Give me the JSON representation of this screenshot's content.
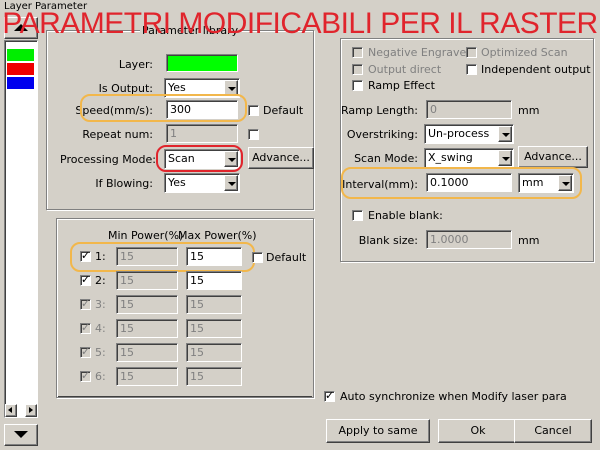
{
  "window": {
    "title": "Layer Parameter"
  },
  "overlay": {
    "text": "PARAMETRI MODIFICABILI PER IL RASTER"
  },
  "left_panel": {
    "swatches": [
      {
        "color": "#00ee00"
      },
      {
        "color": "#ee0000"
      },
      {
        "color": "#0000ee"
      }
    ]
  },
  "params": {
    "group_title": "Parameter library",
    "layer_label": "Layer:",
    "layer_color": "#00ff00",
    "is_output_label": "Is Output:",
    "is_output_value": "Yes",
    "speed_label": "Speed(mm/s):",
    "speed_value": "300",
    "default_label": "Default",
    "repeat_label": "Repeat num:",
    "repeat_value": "1",
    "processing_label": "Processing Mode:",
    "processing_value": "Scan",
    "advance_label": "Advance...",
    "blowing_label": "If Blowing:",
    "blowing_value": "Yes"
  },
  "power": {
    "min_header": "Min Power(%)",
    "max_header": "Max Power(%)",
    "default_label": "Default",
    "rows": [
      {
        "label": "1:",
        "min": "15",
        "max": "15"
      },
      {
        "label": "2:",
        "min": "15",
        "max": "15"
      },
      {
        "label": "3:",
        "min": "15",
        "max": "15"
      },
      {
        "label": "4:",
        "min": "15",
        "max": "15"
      },
      {
        "label": "5:",
        "min": "15",
        "max": "15"
      },
      {
        "label": "6:",
        "min": "15",
        "max": "15"
      }
    ]
  },
  "right": {
    "negative_engrave": "Negative Engrave",
    "optimized_scan": "Optimized Scan",
    "output_direct": "Output direct",
    "independent_output": "Independent output",
    "ramp_effect": "Ramp Effect",
    "ramp_length_label": "Ramp Length:",
    "ramp_length_value": "0",
    "unit_mm": "mm",
    "overstriking_label": "Overstriking:",
    "overstriking_value": "Un-process",
    "scan_mode_label": "Scan Mode:",
    "scan_mode_value": "X_swing",
    "advance_label": "Advance...",
    "interval_label": "Interval(mm):",
    "interval_value": "0.1000",
    "interval_unit": "mm",
    "enable_blank": "Enable blank:",
    "blank_size_label": "Blank size:",
    "blank_size_value": "1.0000",
    "blank_unit": "mm"
  },
  "footer": {
    "auto_sync": "Auto synchronize when Modify laser para",
    "apply_to_same": "Apply to same",
    "ok": "Ok",
    "cancel": "Cancel"
  }
}
